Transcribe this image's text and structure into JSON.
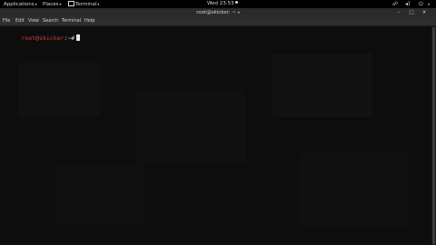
{
  "top_bar": {
    "applications_label": "Applications",
    "places_label": "Places",
    "terminal_label": "Terminal",
    "clock": "Wed 23:53"
  },
  "window": {
    "title": "root@skicker: ~",
    "minimize_glyph": "–",
    "maximize_glyph": "□",
    "close_glyph": "✕"
  },
  "menu": {
    "items": [
      "File",
      "Edit",
      "View",
      "Search",
      "Terminal",
      "Help"
    ]
  },
  "terminal": {
    "prompt_user_host": "root@skicker",
    "prompt_path": ":~",
    "prompt_symbol": "#"
  },
  "icons": {
    "dropdown_arrow": "▾",
    "system_menu_arrow": "▾",
    "network": "☍",
    "volume": "◂)",
    "power": "⏻"
  },
  "colors": {
    "prompt_user": "#d43d3d",
    "terminal_background": "#0d0d0d",
    "top_bar": "#000000",
    "title_bar": "#2b2b2b"
  }
}
